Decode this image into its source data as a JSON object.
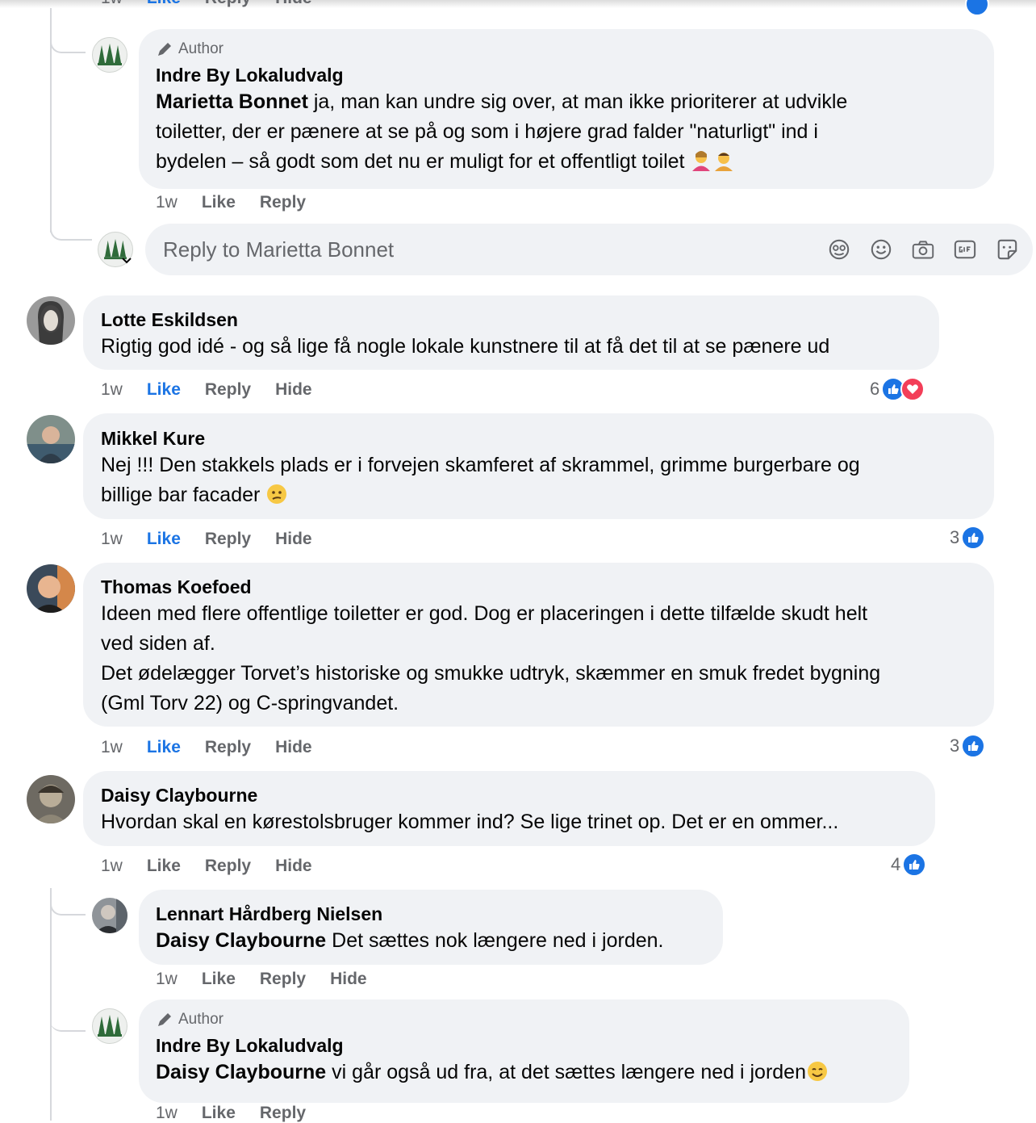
{
  "labels": {
    "author": "Author",
    "time": "1w",
    "like": "Like",
    "reply": "Reply",
    "hide": "Hide"
  },
  "colors": {
    "bubble_bg": "#f0f2f5",
    "liked_blue": "#1b74e4",
    "love_red": "#f33e58",
    "meta_gray": "#65676b"
  },
  "reply_box": {
    "placeholder": "Reply to Marietta Bonnet",
    "icons": [
      "avatar-sticker-icon",
      "emoji-icon",
      "camera-icon",
      "gif-icon",
      "sticker-icon"
    ]
  },
  "comments": [
    {
      "id": "c1",
      "author_tag": true,
      "name": "Indre By Lokaludvalg",
      "mention": "Marietta Bonnet",
      "text_lines": [
        " ja, man kan undre sig over, at man ikke prioriterer at udvikle",
        "toiletter, der er pænere at se på og som i højere grad falder \"naturligt\" ind i",
        "bydelen – så godt som det nu er muligt for et offentligt toilet"
      ],
      "emoji": [
        "person-gesturing-emoji",
        "person-bowing-emoji"
      ],
      "actions": [
        "1w",
        "Like",
        "Reply"
      ]
    },
    {
      "id": "c2",
      "name": "Lotte Eskildsen",
      "text": "Rigtig god idé - og så lige få nogle lokale kunstnere til at få det til at se pænere ud",
      "liked": true,
      "reactions": {
        "count": "6",
        "types": [
          "like",
          "love"
        ]
      }
    },
    {
      "id": "c3",
      "name": "Mikkel Kure",
      "text_lines": [
        "Nej !!! Den stakkels plads er i forvejen skamferet af skrammel, grimme burgerbare og",
        "billige bar facader"
      ],
      "emoji": [
        "confused-face-emoji"
      ],
      "liked": true,
      "reactions": {
        "count": "3",
        "types": [
          "like"
        ]
      }
    },
    {
      "id": "c4",
      "name": "Thomas Koefoed",
      "text_lines": [
        "Ideen med flere offentlige toiletter er god. Dog er placeringen i dette tilfælde skudt helt",
        "ved siden af.",
        "Det ødelægger Torvet’s historiske og smukke udtryk, skæmmer en smuk fredet bygning",
        "(Gml Torv 22) og C-springvandet."
      ],
      "liked": true,
      "reactions": {
        "count": "3",
        "types": [
          "like"
        ]
      }
    },
    {
      "id": "c5",
      "name": "Daisy Claybourne",
      "text": "Hvordan skal en kørestolsbruger kommer ind? Se lige trinet op. Det er en ommer...",
      "liked": false,
      "reactions": {
        "count": "4",
        "types": [
          "like"
        ]
      }
    },
    {
      "id": "c6",
      "name": "Lennart Hårdberg Nielsen",
      "mention": "Daisy Claybourne",
      "text": " Det sættes nok længere ned i jorden."
    },
    {
      "id": "c7",
      "author_tag": true,
      "name": "Indre By Lokaludvalg",
      "mention": "Daisy Claybourne",
      "text": " vi går også ud fra, at det sættes længere ned i jorden",
      "emoji": [
        "smiling-face-emoji"
      ]
    }
  ]
}
